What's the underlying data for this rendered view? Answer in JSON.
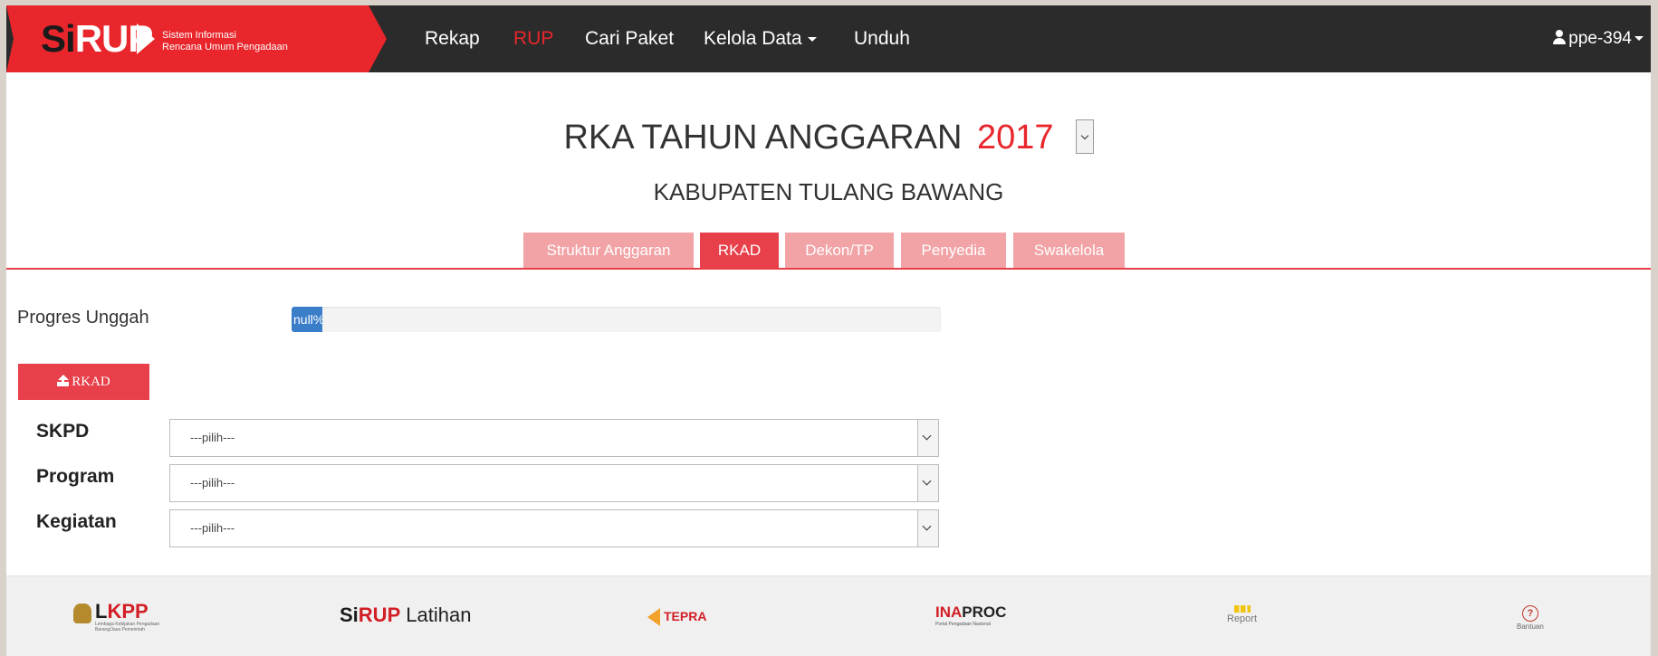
{
  "brand": {
    "logo_prefix": "Si",
    "logo_main": "RUP",
    "sub_line1": "Sistem Informasi",
    "sub_line2": "Rencana Umum Pengadaan"
  },
  "nav": {
    "items": [
      {
        "label": "Rekap"
      },
      {
        "label": "RUP"
      },
      {
        "label": "Cari Paket"
      },
      {
        "label": "Kelola Data"
      },
      {
        "label": "Unduh"
      }
    ],
    "user": "ppe-394"
  },
  "header": {
    "title": "RKA TAHUN ANGGARAN",
    "year": "2017",
    "subtitle": "KABUPATEN TULANG BAWANG"
  },
  "tabs": [
    {
      "label": "Struktur Anggaran"
    },
    {
      "label": "RKAD"
    },
    {
      "label": "Dekon/TP"
    },
    {
      "label": "Penyedia"
    },
    {
      "label": "Swakelola"
    }
  ],
  "progress": {
    "label": "Progres Unggah",
    "text": "null%"
  },
  "upload_button": "RKAD",
  "form": {
    "skpd": {
      "label": "SKPD",
      "value": "---pilih---"
    },
    "program": {
      "label": "Program",
      "value": "---pilih---"
    },
    "kegiatan": {
      "label": "Kegiatan",
      "value": "---pilih---"
    }
  },
  "footer": {
    "lkpp": {
      "logo_l": "L",
      "logo_rest": "KPP",
      "sub": "Lembaga Kebijakan Pengadaan Barang/Jasa Pemerintah"
    },
    "sirup": {
      "prefix": "Si",
      "main": "RUP",
      "tag": "Latihan"
    },
    "tepra": "TEPRA",
    "inaproc": {
      "ina": "INA",
      "proc": "PROC",
      "sub": "Portal Pengadaan Nasional"
    },
    "report": "Report",
    "help": "Bantuan"
  }
}
